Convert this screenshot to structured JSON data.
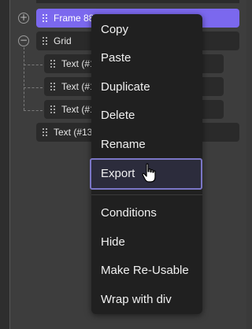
{
  "layers": {
    "frame_label": "Frame 88",
    "grid_label": "Grid",
    "text_rows": [
      "Text (#1",
      "Text (#1",
      "Text (#1"
    ],
    "bottom_text": "Text (#13"
  },
  "context_menu": {
    "items": [
      {
        "label": "Copy"
      },
      {
        "label": "Paste"
      },
      {
        "label": "Duplicate"
      },
      {
        "label": "Delete"
      },
      {
        "label": "Rename"
      },
      {
        "label": "Export"
      },
      {
        "label": "Conditions"
      },
      {
        "label": "Hide"
      },
      {
        "label": "Make Re-Usable"
      },
      {
        "label": "Wrap with div"
      }
    ],
    "hovered_item": "Export"
  },
  "icons": {
    "expand": "plus-circle-icon",
    "collapse": "minus-circle-icon",
    "drag": "drag-handle-icon",
    "pointer": "hand-pointer-cursor-icon"
  },
  "colors": {
    "selection": "#7b68ee",
    "menu_bg": "#202020",
    "hover_border": "#7b76c7"
  }
}
